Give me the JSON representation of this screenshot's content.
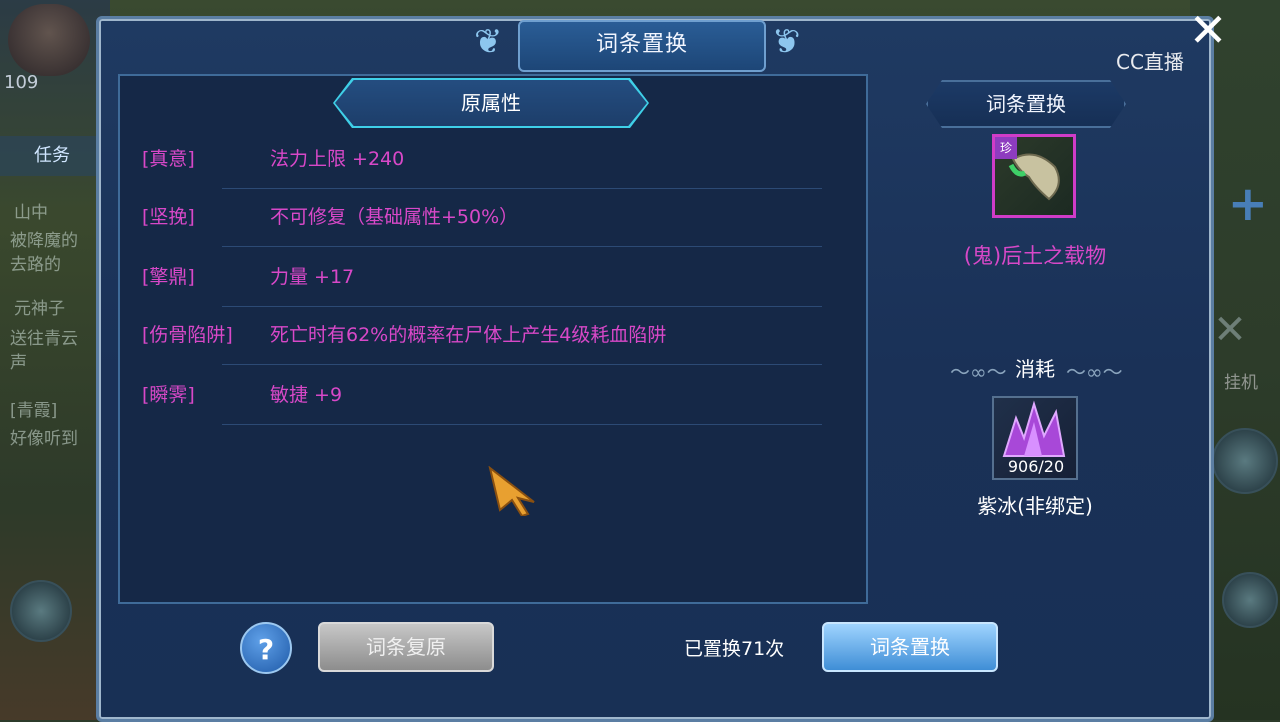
{
  "background": {
    "level": "109",
    "side_tab": "任务",
    "side_lines": [
      "山中",
      "被降魔的",
      "去路的",
      "元神子",
      "送往青云",
      "声",
      "[青霞]",
      "好像听到"
    ],
    "side_label_right": "挂机"
  },
  "dialog": {
    "title": "词条置换",
    "section_title": "原属性",
    "attributes": [
      {
        "tag": "[真意]",
        "value": "法力上限 +240"
      },
      {
        "tag": "[坚挽]",
        "value": "不可修复（基础属性+50%）"
      },
      {
        "tag": "[擎鼎]",
        "value": "力量 +17"
      },
      {
        "tag": "[伤骨陷阱]",
        "value": "死亡时有62%的概率在尸体上产生4级耗血陷阱"
      },
      {
        "tag": "[瞬霁]",
        "value": "敏捷 +9"
      }
    ],
    "right": {
      "title": "词条置换",
      "item_rarity_badge": "珍",
      "item_name": "(鬼)后土之载物",
      "consume_title": "消耗",
      "material_count": "906/20",
      "material_name": "紫冰(非绑定)"
    },
    "bottom": {
      "help_label": "?",
      "restore_label": "词条复原",
      "replaced_text": "已置换71次",
      "replace_label": "词条置换"
    }
  },
  "overlay": {
    "close_label": "✕",
    "cc_logo": "CC直播"
  },
  "colors": {
    "attribute_text": "#d848c8",
    "item_border": "#d03cc8",
    "title_bar": "#2a5d96",
    "replace_button": "#3f8ed6"
  }
}
